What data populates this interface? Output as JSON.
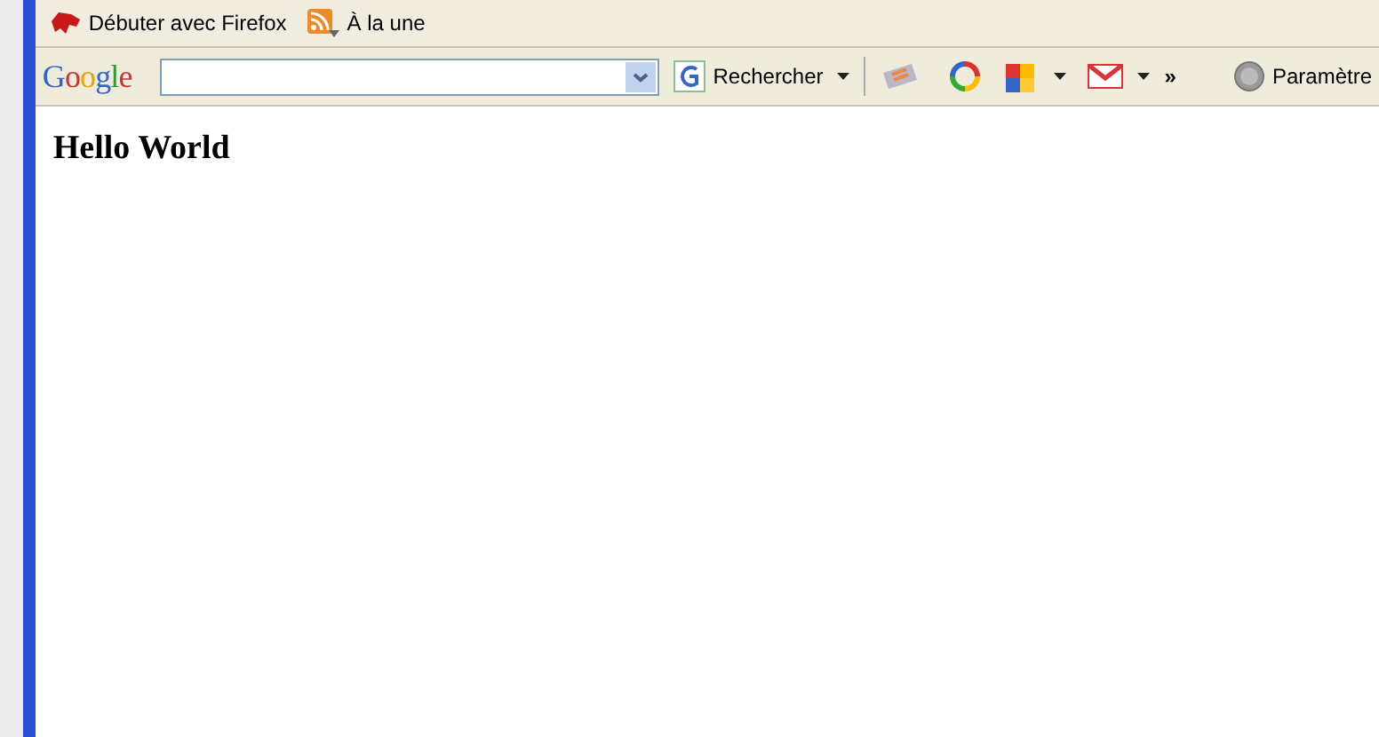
{
  "bookmarks": [
    {
      "label": "Débuter avec Firefox",
      "kind": "firefox"
    },
    {
      "label": "À la une",
      "kind": "rss"
    }
  ],
  "google_toolbar": {
    "logo": "Google",
    "search_button": "Rechercher",
    "more": "»",
    "settings": "Paramètre"
  },
  "page": {
    "heading": "Hello World"
  }
}
